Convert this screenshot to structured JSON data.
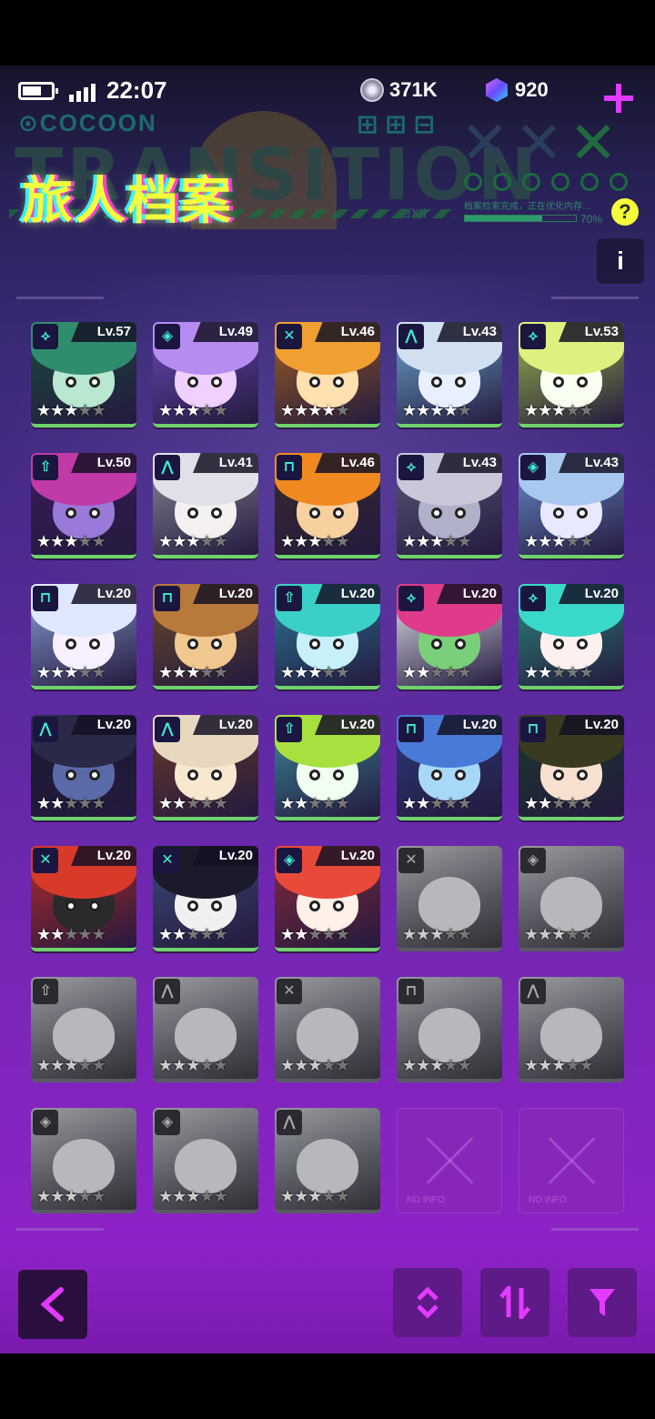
{
  "status": {
    "time": "22:07"
  },
  "currency": {
    "coins": "371K",
    "gems": "920"
  },
  "header": {
    "title": "旅人档案",
    "brand": "COCOON",
    "background_word": "TRANSITION",
    "small_info": "档案检索完成，正在优化内存…",
    "progress_label": "70%",
    "progress_percent": 70
  },
  "info_label": "i",
  "help_label": "?",
  "characters": [
    {
      "level": "Lv.57",
      "stars": 3,
      "icon": "⟡",
      "unlocked": true,
      "hair": "#2f8d6e",
      "skin": "#b8e8d0",
      "bg": "#1a4a3c"
    },
    {
      "level": "Lv.49",
      "stars": 3,
      "icon": "◈",
      "unlocked": true,
      "hair": "#b68cf0",
      "skin": "#f0d0ff",
      "bg": "#6a48b8"
    },
    {
      "level": "Lv.46",
      "stars": 4,
      "icon": "✕",
      "unlocked": true,
      "hair": "#f0a030",
      "skin": "#ffe0b0",
      "bg": "#a06020"
    },
    {
      "level": "Lv.43",
      "stars": 4,
      "icon": "⋀",
      "unlocked": true,
      "hair": "#d0e0f0",
      "skin": "#e8f0ff",
      "bg": "#6aa8d0"
    },
    {
      "level": "Lv.53",
      "stars": 3,
      "icon": "⟡",
      "unlocked": true,
      "hair": "#e0f080",
      "skin": "#f8fff0",
      "bg": "#9ab84a"
    },
    {
      "level": "Lv.50",
      "stars": 3,
      "icon": "⇧",
      "unlocked": true,
      "hair": "#c03aa8",
      "skin": "#9a7ad8",
      "bg": "#3a1a5a"
    },
    {
      "level": "Lv.41",
      "stars": 3,
      "icon": "⋀",
      "unlocked": true,
      "hair": "#e0e0e8",
      "skin": "#f4f0f0",
      "bg": "#8a8a98"
    },
    {
      "level": "Lv.46",
      "stars": 3,
      "icon": "⊓",
      "unlocked": true,
      "hair": "#f08a20",
      "skin": "#f8d0a0",
      "bg": "#3a2a2a"
    },
    {
      "level": "Lv.43",
      "stars": 3,
      "icon": "⟡",
      "unlocked": true,
      "hair": "#c8c8d8",
      "skin": "#b0b0c8",
      "bg": "#5a5a78"
    },
    {
      "level": "Lv.43",
      "stars": 3,
      "icon": "◈",
      "unlocked": true,
      "hair": "#a8c8f0",
      "skin": "#e8e8ff",
      "bg": "#6a90d0"
    },
    {
      "level": "Lv.20",
      "stars": 3,
      "icon": "⊓",
      "unlocked": true,
      "hair": "#e0e8ff",
      "skin": "#f8f0ff",
      "bg": "#8aa0d8"
    },
    {
      "level": "Lv.20",
      "stars": 3,
      "icon": "⊓",
      "unlocked": true,
      "hair": "#b87a3a",
      "skin": "#f0c890",
      "bg": "#6a4a2a"
    },
    {
      "level": "Lv.20",
      "stars": 3,
      "icon": "⇧",
      "unlocked": true,
      "hair": "#3ad0c8",
      "skin": "#c8f0f8",
      "bg": "#2a7a9a"
    },
    {
      "level": "Lv.20",
      "stars": 2,
      "icon": "⟡",
      "unlocked": true,
      "hair": "#e03a8a",
      "skin": "#7ad07a",
      "bg": "#e8e8f0"
    },
    {
      "level": "Lv.20",
      "stars": 2,
      "icon": "⟡",
      "unlocked": true,
      "hair": "#3ad8c8",
      "skin": "#fff0f0",
      "bg": "#2a8a7a"
    },
    {
      "level": "Lv.20",
      "stars": 2,
      "icon": "⋀",
      "unlocked": true,
      "hair": "#2a2a48",
      "skin": "#5a6aa8",
      "bg": "#1a1a30"
    },
    {
      "level": "Lv.20",
      "stars": 2,
      "icon": "⋀",
      "unlocked": true,
      "hair": "#e8d8c0",
      "skin": "#f8e8d0",
      "bg": "#6a3a2a"
    },
    {
      "level": "Lv.20",
      "stars": 2,
      "icon": "⇧",
      "unlocked": true,
      "hair": "#a8e040",
      "skin": "#f0fff0",
      "bg": "#3a8a9a"
    },
    {
      "level": "Lv.20",
      "stars": 2,
      "icon": "⊓",
      "unlocked": true,
      "hair": "#4a7ad8",
      "skin": "#a8d8f8",
      "bg": "#2a3a7a"
    },
    {
      "level": "Lv.20",
      "stars": 2,
      "icon": "⊓",
      "unlocked": true,
      "hair": "#3a3a20",
      "skin": "#f8e0d0",
      "bg": "#1a3a2a"
    },
    {
      "level": "Lv.20",
      "stars": 2,
      "icon": "✕",
      "unlocked": true,
      "hair": "#d83a2a",
      "skin": "#2a2a2a",
      "bg": "#b82a2a"
    },
    {
      "level": "Lv.20",
      "stars": 2,
      "icon": "✕",
      "unlocked": true,
      "hair": "#1a1a2a",
      "skin": "#f0f0f0",
      "bg": "#3a4a7a"
    },
    {
      "level": "Lv.20",
      "stars": 2,
      "icon": "◈",
      "unlocked": true,
      "hair": "#e84a3a",
      "skin": "#fff0e8",
      "bg": "#8a2a3a"
    },
    {
      "level": "",
      "stars": 3,
      "icon": "✕",
      "unlocked": false
    },
    {
      "level": "",
      "stars": 3,
      "icon": "◈",
      "unlocked": false
    },
    {
      "level": "",
      "stars": 3,
      "icon": "⇧",
      "unlocked": false
    },
    {
      "level": "",
      "stars": 3,
      "icon": "⋀",
      "unlocked": false
    },
    {
      "level": "",
      "stars": 3,
      "icon": "✕",
      "unlocked": false
    },
    {
      "level": "",
      "stars": 3,
      "icon": "⊓",
      "unlocked": false
    },
    {
      "level": "",
      "stars": 3,
      "icon": "⋀",
      "unlocked": false
    },
    {
      "level": "",
      "stars": 3,
      "icon": "◈",
      "unlocked": false
    },
    {
      "level": "",
      "stars": 3,
      "icon": "◈",
      "unlocked": false
    },
    {
      "level": "",
      "stars": 3,
      "icon": "⋀",
      "unlocked": false
    },
    {
      "level": "",
      "stars": 0,
      "icon": "",
      "unlocked": false,
      "empty": true,
      "noinfo": "NO INFO"
    },
    {
      "level": "",
      "stars": 0,
      "icon": "",
      "unlocked": false,
      "empty": true,
      "noinfo": "NO INFO"
    }
  ],
  "bottom_nav": {
    "back_icon": "back-chevron-icon",
    "sort_icon": "sort-updown-icon",
    "order_icon": "swap-order-icon",
    "filter_icon": "filter-icon"
  },
  "colors": {
    "accent": "#e23bff",
    "title": "#f3ff3a",
    "level_bar": "#6fd26c"
  }
}
